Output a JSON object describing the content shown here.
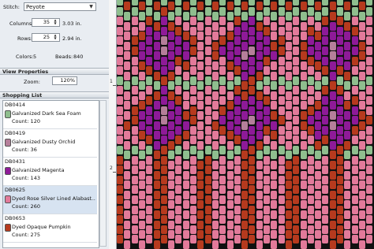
{
  "stitch": {
    "label": "Stitch:",
    "value": "Peyote"
  },
  "columns": {
    "label": "Columns:",
    "value": "35",
    "size": "3.03 in."
  },
  "rows": {
    "label": "Rows:",
    "value": "25",
    "size": "2.94 in."
  },
  "colors": {
    "label": "Colors:",
    "value": "5"
  },
  "beads": {
    "label": "Beads:",
    "value": "840"
  },
  "view": {
    "header": "View Properties",
    "zoom_label": "Zoom:",
    "zoom_value": "120%"
  },
  "shopping": {
    "header": "Shopping List",
    "items": [
      {
        "code": "DB0414",
        "name": "Galvanized Dark Sea Foam",
        "count": "Count: 120",
        "color": "#8fbe8e"
      },
      {
        "code": "DB0419",
        "name": "Galvanized Dusty Orchid",
        "count": "Count: 36",
        "color": "#b57f9a"
      },
      {
        "code": "DB0431",
        "name": "Galvanized Magenta",
        "count": "Count: 143",
        "color": "#8e1a98"
      },
      {
        "code": "DB0625",
        "name": "Dyed Rose Silver Lined Alabast...",
        "count": "Count: 260",
        "color": "#e27a9a"
      },
      {
        "code": "DB0653",
        "name": "Dyed Opaque Pumpkin",
        "count": "Count: 275",
        "color": "#b63a1e"
      }
    ]
  },
  "ruler": {
    "marks": [
      "1",
      "2"
    ]
  },
  "colors_map": {
    "G": "#8fbe8e",
    "O": "#b57f9a",
    "M": "#8e1a98",
    "P": "#e27a9a",
    "R": "#b63a1e"
  }
}
